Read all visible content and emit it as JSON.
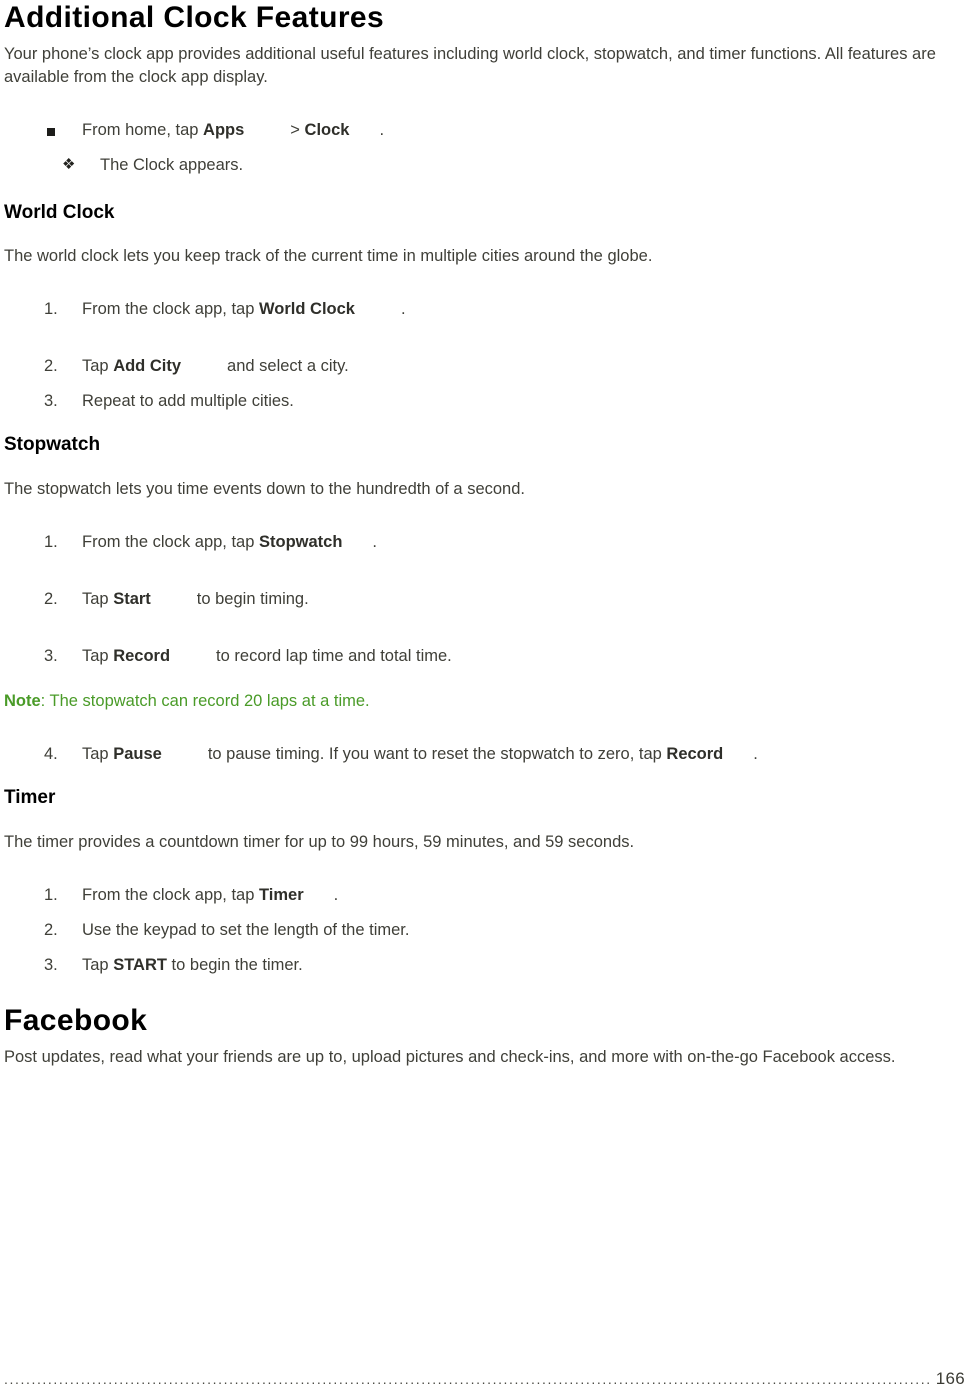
{
  "document": {
    "title": "Additional Clock Features",
    "intro": "Your phone’s clock app provides additional useful features including world clock, stopwatch, and timer functions. All features are available from the clock app display.",
    "open_step": {
      "text_before": "From home, tap ",
      "bold_apps": "Apps",
      "separator": "> ",
      "bold_clock": "Clock",
      "text_after": "."
    },
    "open_result": "The Clock appears."
  },
  "world_clock": {
    "heading": "World Clock",
    "description": "The world clock lets you keep track of the current time in multiple cities around the globe.",
    "steps": [
      {
        "number": "1.",
        "text_before": "From the clock app, tap ",
        "bold": "World Clock",
        "text_after": "."
      },
      {
        "number": "2.",
        "text_before": "Tap ",
        "bold": "Add City",
        "text_after": "and select a city."
      },
      {
        "number": "3.",
        "text_before": "Repeat to add multiple cities.",
        "bold": "",
        "text_after": ""
      }
    ]
  },
  "stopwatch": {
    "heading": "Stopwatch",
    "description": "The stopwatch lets you time events down to the hundredth of a second.",
    "steps": [
      {
        "number": "1.",
        "text_before": "From the clock app, tap ",
        "bold": "Stopwatch",
        "text_after": "."
      },
      {
        "number": "2.",
        "text_before": "Tap ",
        "bold": "Start",
        "text_after": "to begin timing."
      },
      {
        "number": "3.",
        "text_before": "Tap ",
        "bold": "Record",
        "text_after": "to record lap time and total time."
      }
    ],
    "note": {
      "label": "Note",
      "text": ": The stopwatch can record 20 laps at a time."
    },
    "step_four": {
      "number": "4.",
      "text_before": "Tap ",
      "bold_pause": "Pause",
      "text_middle": "to pause timing. If you want to reset the stopwatch to zero, tap ",
      "bold_record": "Record",
      "text_after": "."
    }
  },
  "timer": {
    "heading": "Timer",
    "description": "The timer provides a countdown timer for up to 99 hours, 59 minutes, and 59 seconds.",
    "steps": [
      {
        "number": "1.",
        "text_before": "From the clock app, tap ",
        "bold": "Timer",
        "text_after": "."
      },
      {
        "number": "2.",
        "text_before": "Use the keypad to set the length of the timer.",
        "bold": "",
        "text_after": ""
      },
      {
        "number": "3.",
        "text_before": "Tap ",
        "bold": "START",
        "text_after": " to begin the timer."
      }
    ]
  },
  "facebook": {
    "heading": "Facebook",
    "description": "Post updates, read what your friends are up to, upload pictures and check-ins, and more with on-the-go Facebook access."
  },
  "footer": {
    "leader": "........................................................................................................................................................................................................................",
    "page_number": "166"
  },
  "colors": {
    "body_text": "#3f3f38",
    "heading": "#000000",
    "note_green": "#4a9b28",
    "bullet": "#1d1d1a"
  }
}
